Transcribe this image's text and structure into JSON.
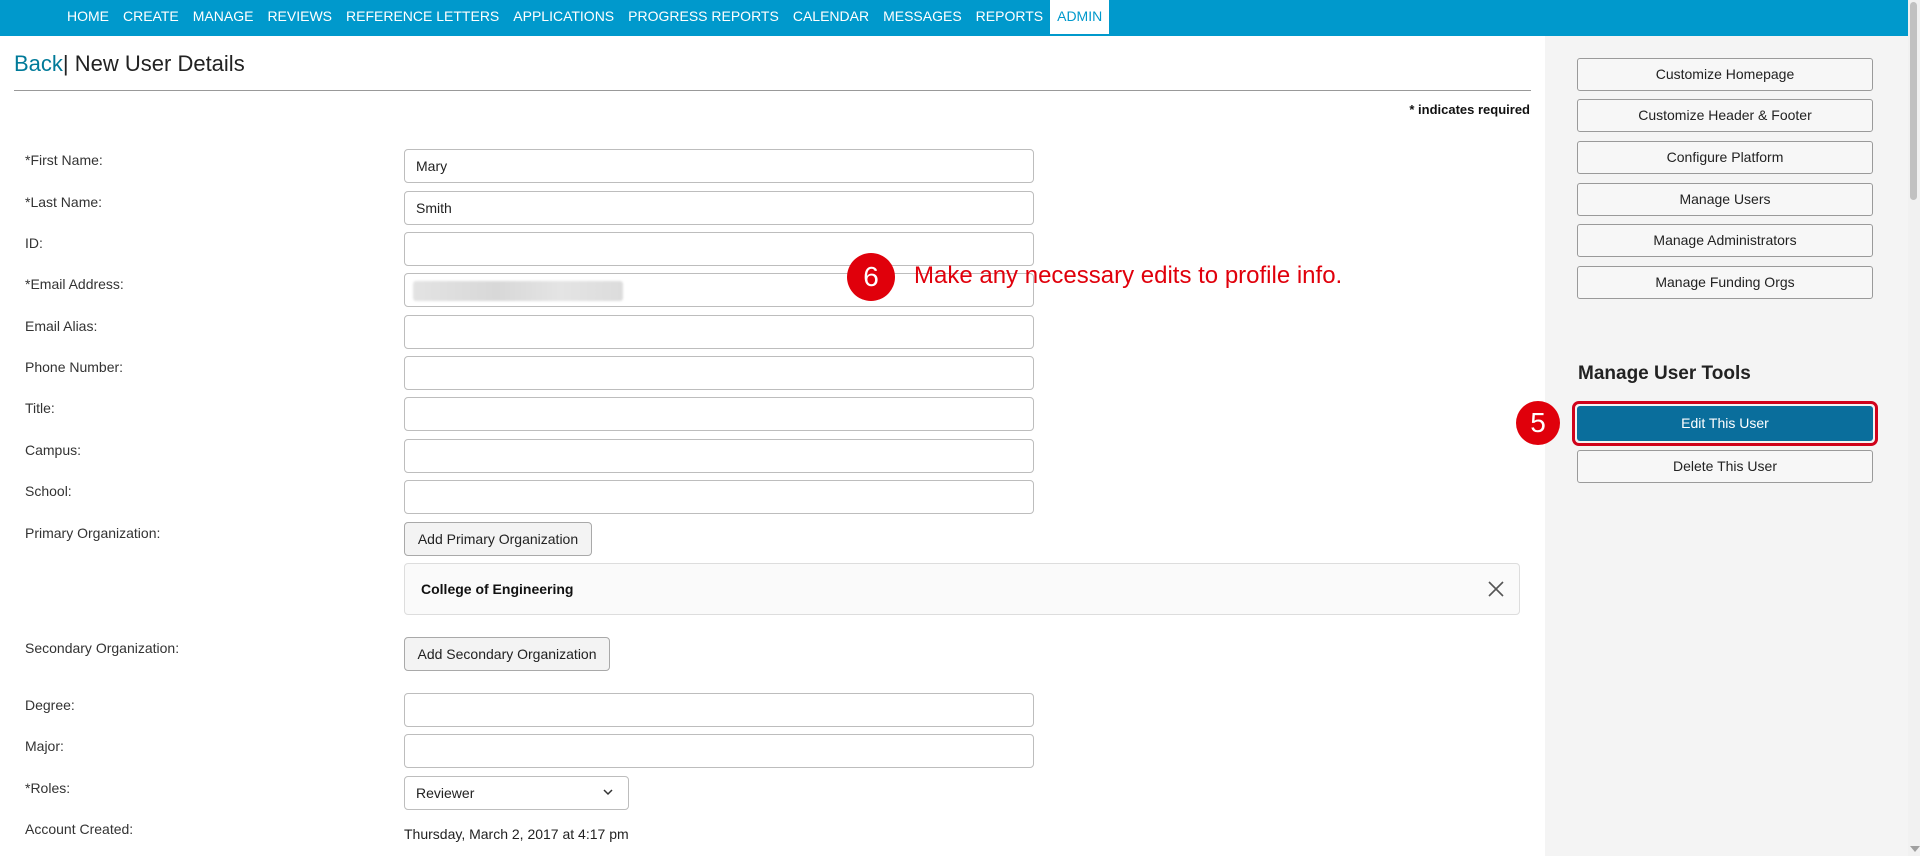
{
  "nav": {
    "items": [
      "HOME",
      "CREATE",
      "MANAGE",
      "REVIEWS",
      "REFERENCE LETTERS",
      "APPLICATIONS",
      "PROGRESS REPORTS",
      "CALENDAR",
      "MESSAGES",
      "REPORTS",
      "ADMIN"
    ],
    "active": "ADMIN"
  },
  "header": {
    "back": "Back",
    "separator": "|",
    "title": "New User Details"
  },
  "required_note": "* indicates required",
  "form": {
    "first_name_label": "*First Name:",
    "first_name_value": "Mary",
    "last_name_label": "*Last Name:",
    "last_name_value": "Smith",
    "id_label": "ID:",
    "email_label": "*Email Address:",
    "email_alias_label": "Email Alias:",
    "phone_label": "Phone Number:",
    "title_label": "Title:",
    "campus_label": "Campus:",
    "school_label": "School:",
    "primary_org_label": "Primary Organization:",
    "add_primary_org": "Add Primary Organization",
    "primary_org_value": "College of Engineering",
    "secondary_org_label": "Secondary Organization:",
    "add_secondary_org": "Add Secondary Organization",
    "degree_label": "Degree:",
    "major_label": "Major:",
    "roles_label": "*Roles:",
    "roles_value": "Reviewer",
    "account_created_label": "Account Created:",
    "account_created_value": "Thursday, March 2, 2017 at 4:17 pm"
  },
  "sidebar": {
    "buttons": [
      "Customize Homepage",
      "Customize Header & Footer",
      "Configure Platform",
      "Manage Users",
      "Manage Administrators",
      "Manage Funding Orgs"
    ],
    "tools_heading": "Manage User Tools",
    "edit_user": "Edit This User",
    "delete_user": "Delete This User"
  },
  "annotations": {
    "step5": "5",
    "step6": "6",
    "step6_text": "Make any necessary edits to profile info."
  },
  "colors": {
    "nav_bg": "#0099cc",
    "link": "#007a99",
    "primary_btn": "#0a6e9c",
    "annotation": "#e0000b"
  }
}
